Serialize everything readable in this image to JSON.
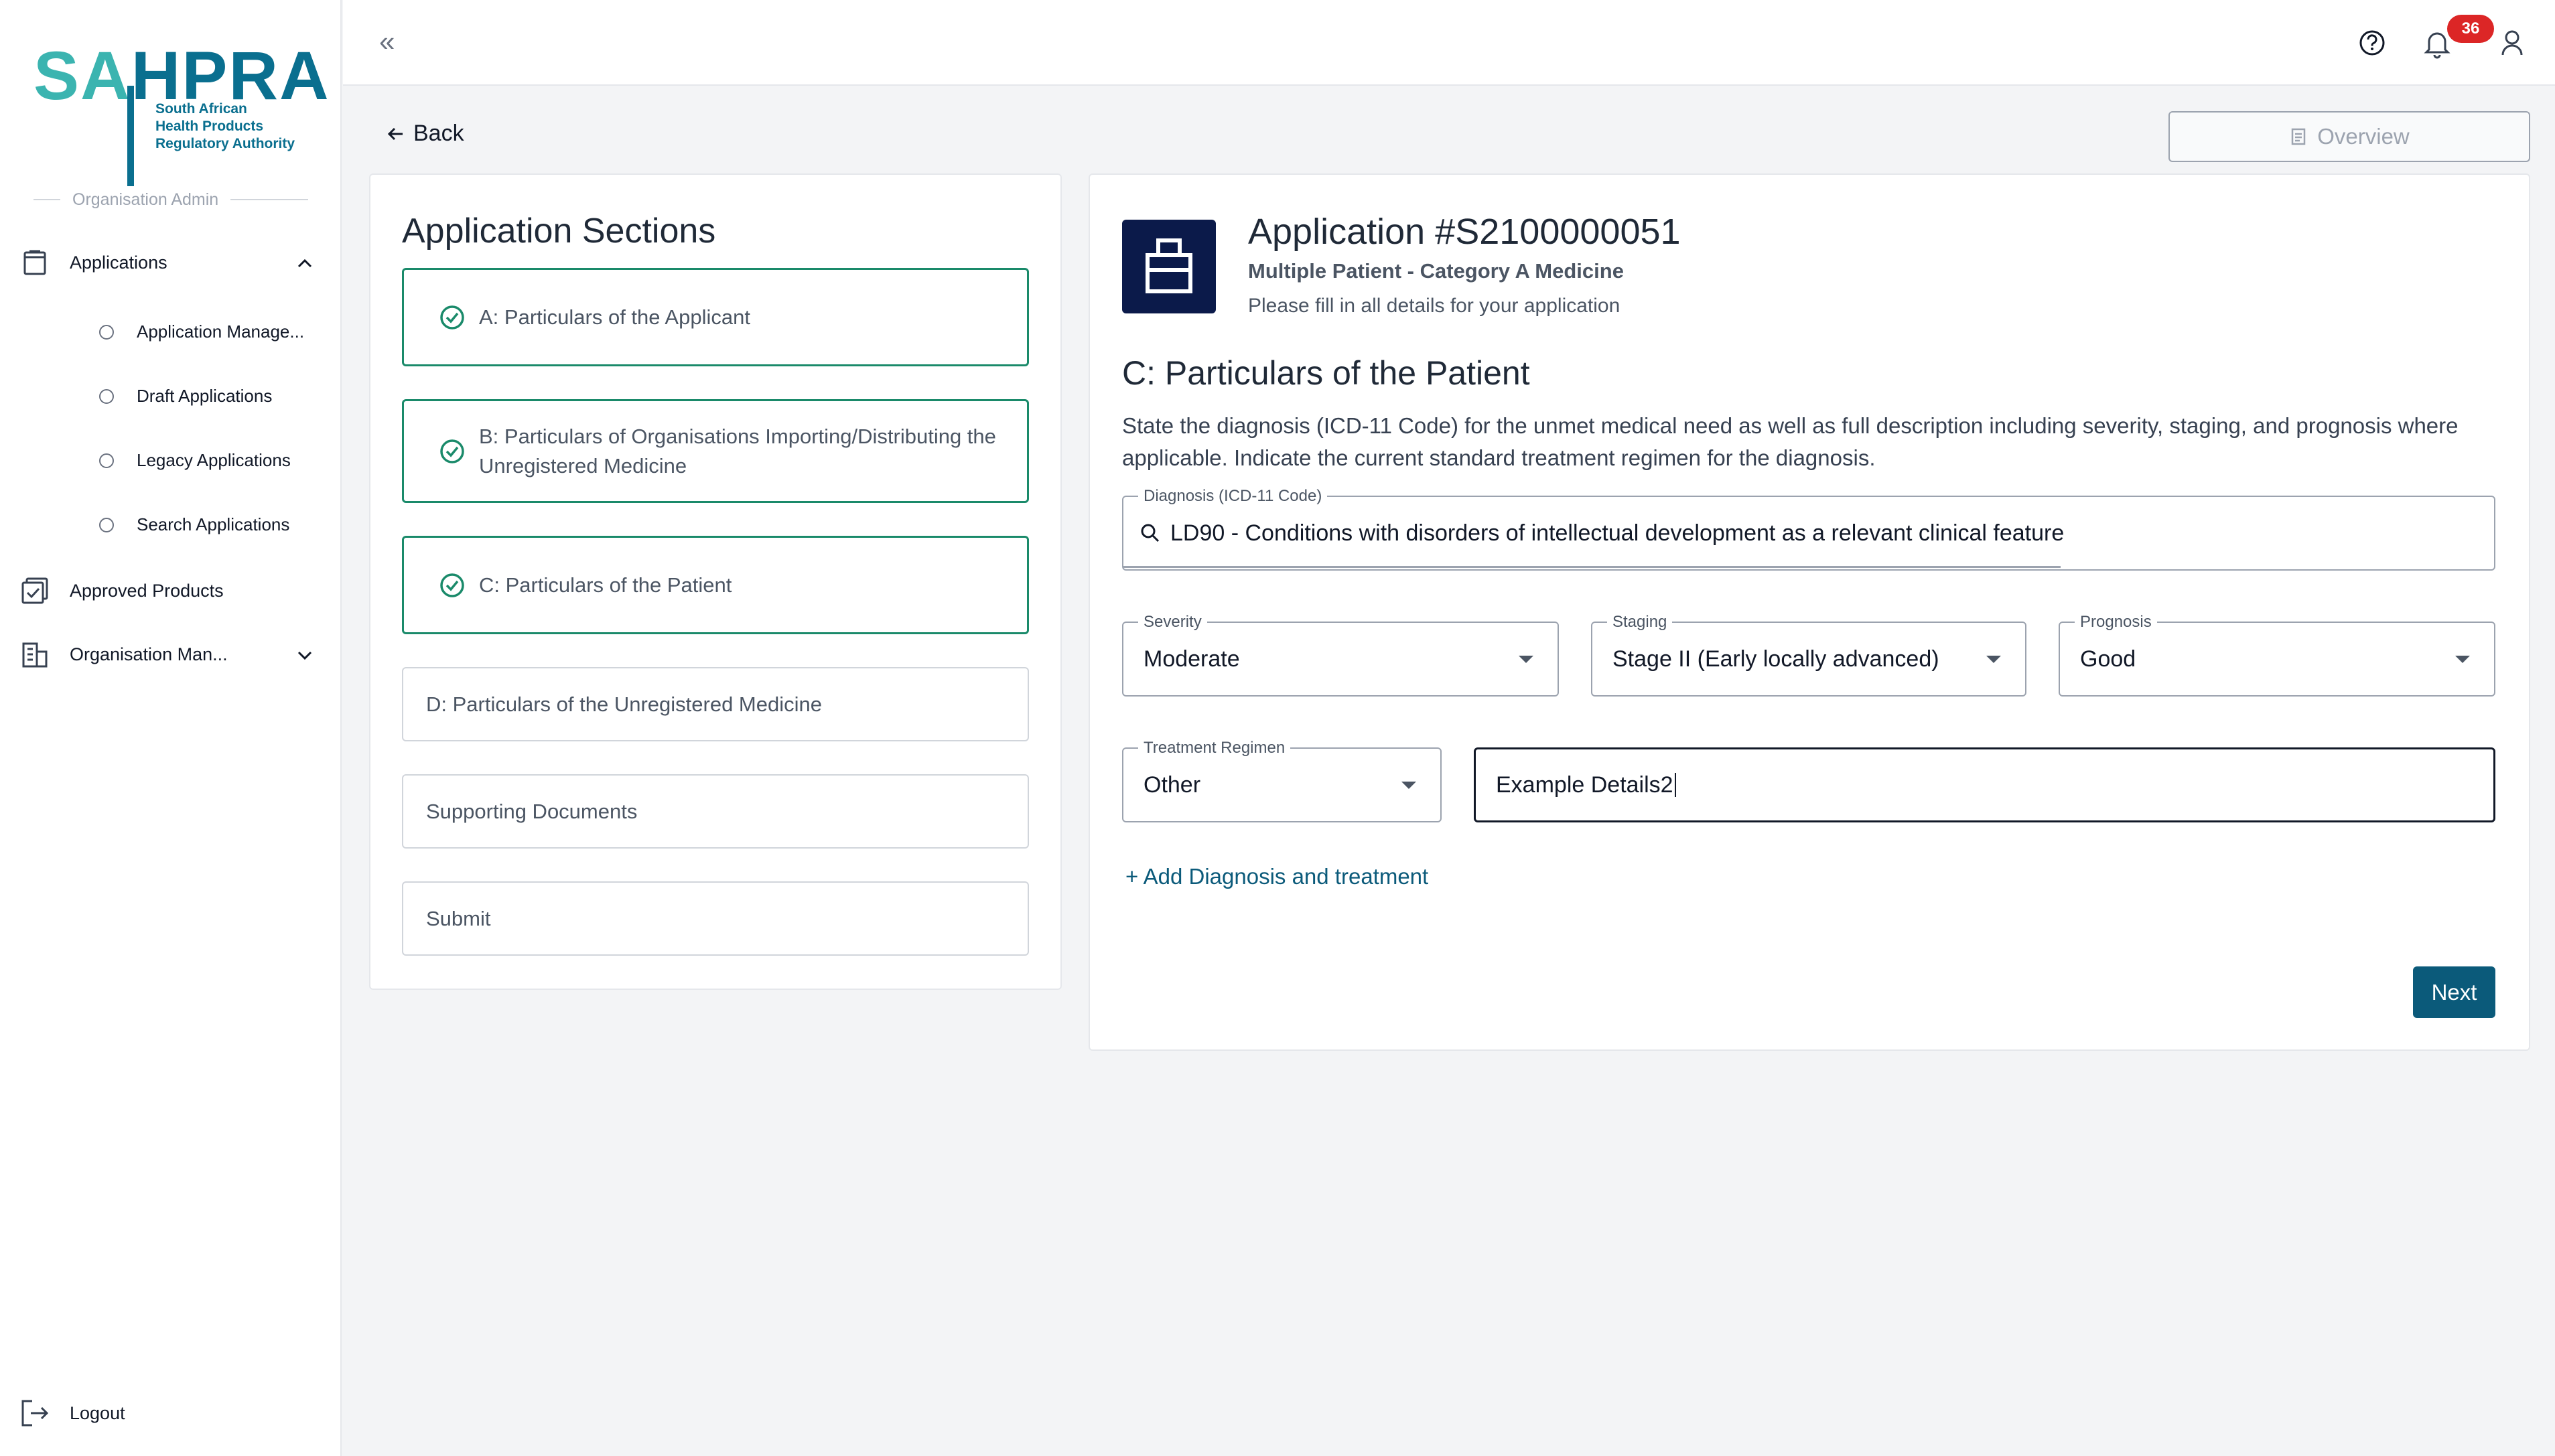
{
  "logo": {
    "brand_a": "SA",
    "brand_b": "HPRA",
    "tagline": [
      "South African",
      "Health Products",
      "Regulatory Authority"
    ]
  },
  "sidebar": {
    "role": "Organisation Admin",
    "applications_label": "Applications",
    "sub_items": [
      {
        "label": "Application Manage..."
      },
      {
        "label": "Draft Applications"
      },
      {
        "label": "Legacy Applications"
      },
      {
        "label": "Search Applications"
      }
    ],
    "approved_products_label": "Approved Products",
    "org_management_label": "Organisation Man...",
    "logout_label": "Logout"
  },
  "topbar": {
    "collapse_glyph": "«",
    "notification_count": "36"
  },
  "nav": {
    "back_label": "Back",
    "overview_label": "Overview"
  },
  "sections": {
    "title": "Application Sections",
    "items": [
      {
        "label": "A: Particulars of the Applicant",
        "status": "complete"
      },
      {
        "label": "B: Particulars of Organisations Importing/Distributing the Unregistered Medicine",
        "status": "complete"
      },
      {
        "label": "C: Particulars of the Patient",
        "status": "complete"
      },
      {
        "label": "D: Particulars of the Unregistered Medicine",
        "status": "incomplete"
      },
      {
        "label": "Supporting Documents",
        "status": "incomplete"
      },
      {
        "label": "Submit",
        "status": "incomplete"
      }
    ]
  },
  "application": {
    "title": "Application #S2100000051",
    "subtitle": "Multiple Patient - Category A Medicine",
    "hint": "Please fill in all details for your application"
  },
  "form": {
    "heading": "C: Particulars of the Patient",
    "description": "State the diagnosis (ICD-11 Code) for the unmet medical need as well as full description including severity, staging, and prognosis where applicable. Indicate the current standard treatment regimen for the diagnosis.",
    "diagnosis": {
      "label": "Diagnosis (ICD-11 Code)",
      "value": "LD90 - Conditions with disorders of intellectual development as a relevant clinical feature"
    },
    "severity": {
      "label": "Severity",
      "value": "Moderate"
    },
    "staging": {
      "label": "Staging",
      "value": "Stage II (Early locally advanced)"
    },
    "prognosis": {
      "label": "Prognosis",
      "value": "Good"
    },
    "treatment": {
      "label": "Treatment Regimen",
      "value": "Other"
    },
    "treatment_details": {
      "value": "Example Details2"
    },
    "add_link": "+ Add Diagnosis and treatment",
    "next_label": "Next"
  },
  "colors": {
    "brand_teal": "#3bb4b0",
    "brand_blue": "#0a6f8f",
    "complete_green": "#1a8a6a",
    "primary_button": "#0b5a7a",
    "badge_red": "#dc2626"
  }
}
